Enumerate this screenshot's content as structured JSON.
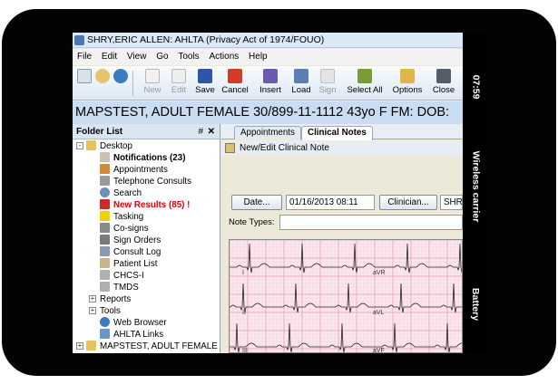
{
  "window": {
    "title": "SHRY,ERIC ALLEN: AHLTA (Privacy Act of 1974/FOUO)"
  },
  "menu": [
    "File",
    "Edit",
    "View",
    "Go",
    "Tools",
    "Actions",
    "Help"
  ],
  "toolbar": {
    "new": "New",
    "edit": "Edit",
    "save": "Save",
    "cancel": "Cancel",
    "insert": "Insert",
    "load": "Load",
    "sign": "Sign",
    "select_all": "Select All",
    "options": "Options",
    "close": "Close"
  },
  "patient_banner": "MAPSTEST, ADULT FEMALE  30/899-11-1112  43yo  F   FM:  DOB:",
  "folder_list": {
    "title": "Folder List",
    "pin": "#",
    "close": "✕",
    "desktop": "Desktop",
    "items": [
      "Notifications (23)",
      "Appointments",
      "Telephone Consults",
      "Search",
      "New Results (85) !",
      "Tasking",
      "Co-signs",
      "Sign Orders",
      "Consult Log",
      "Patient List",
      "CHCS-I",
      "TMDS"
    ],
    "groups": [
      "Reports",
      "Tools"
    ],
    "links": [
      "Web Browser",
      "AHLTA Links"
    ],
    "patient_folder": "MAPSTEST, ADULT FEMALE"
  },
  "tabs": {
    "appointments": "Appointments",
    "clinical_notes": "Clinical Notes"
  },
  "note": {
    "header": "New/Edit Clinical Note",
    "date_button": "Date...",
    "date_value": "01/16/2013 08:11",
    "clinician_button": "Clinician...",
    "clinician_value": "SHRY",
    "note_types_label": "Note Types:",
    "note_types_value": ""
  },
  "ecg_leads": [
    "I",
    "aVR",
    "II",
    "aVL",
    "III",
    "aVF"
  ],
  "status_bar": {
    "time": "07:59",
    "carrier": "Wireless carrier",
    "battery": "Battery"
  },
  "colors": {
    "bezel": "#030303",
    "banner": "#c9dcf1",
    "ecg_paper": "#fbe8ee",
    "alert_red": "#e00000"
  }
}
